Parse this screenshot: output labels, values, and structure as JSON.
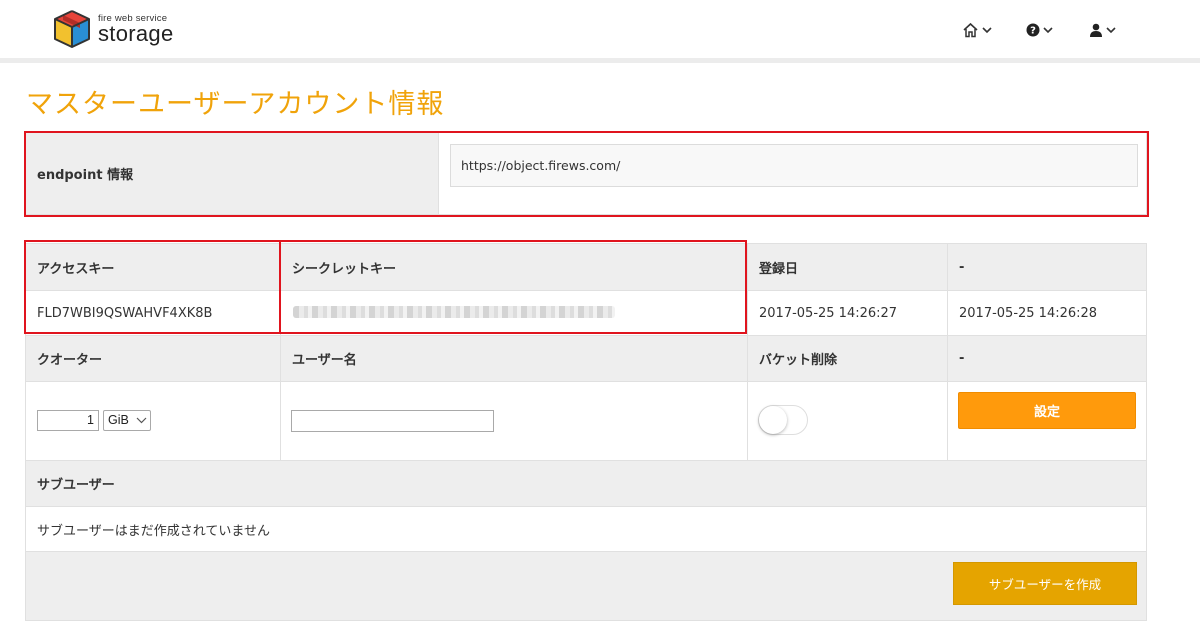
{
  "header": {
    "logo_sub": "fire web service",
    "logo_name": "storage",
    "nav_icons": [
      "home-icon",
      "help-icon",
      "user-icon"
    ]
  },
  "page": {
    "title": "マスターユーザーアカウント情報"
  },
  "endpoint": {
    "label": "endpoint 情報",
    "value": "https://object.firews.com/"
  },
  "table": {
    "access_key_label": "アクセスキー",
    "access_key_value": "FLD7WBI9QSWAHVF4XK8B",
    "secret_key_label": "シークレットキー",
    "registered_label": "登録日",
    "registered_value": "2017-05-25 14:26:27",
    "dash_label_1": "-",
    "updated_value": "2017-05-25 14:26:28",
    "quota_label": "クオーター",
    "quota_value": "1",
    "quota_unit": "GiB",
    "username_label": "ユーザー名",
    "bucket_delete_label": "バケット削除",
    "dash_label_2": "-",
    "settings_button": "設定"
  },
  "subusers": {
    "label": "サブユーザー",
    "empty_message": "サブユーザーはまだ作成されていません",
    "create_button": "サブユーザーを作成"
  },
  "colors": {
    "accent_orange": "#ff9a0c",
    "title_orange": "#f0a30a",
    "highlight_red": "#e0141e"
  }
}
